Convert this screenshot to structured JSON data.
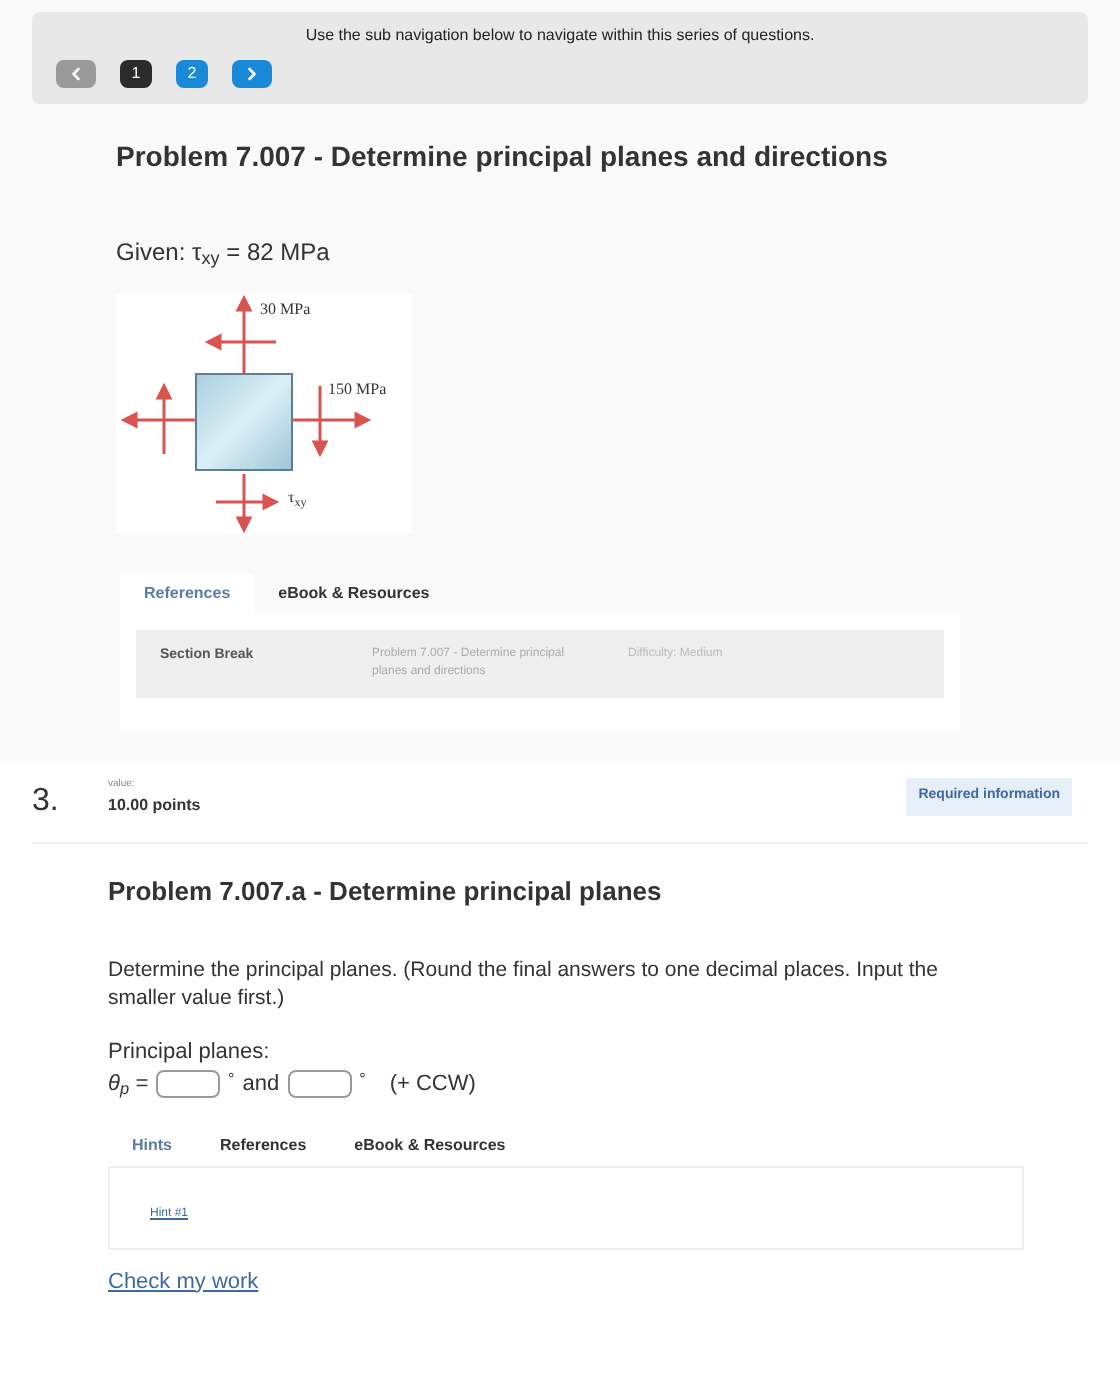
{
  "sub_navigation": {
    "instruction": "Use the sub navigation below to navigate within this series of questions.",
    "prev_disabled": true,
    "pages": [
      {
        "label": "1",
        "selected": true
      },
      {
        "label": "2",
        "selected": false
      }
    ]
  },
  "problem": {
    "title": "Problem 7.007 - Determine principal planes and directions",
    "given": "Given: τ$_{xy}$ = 82 MPa",
    "figure_labels": [
      "30 MPa",
      "150 MPa",
      "τ$_{xy}$"
    ],
    "tabs": [
      {
        "label": "References",
        "selected": true
      },
      {
        "label": "eBook & Resources",
        "selected": false
      }
    ],
    "section": {
      "label": "Section Break",
      "description": "Problem 7.007 - Determine principal planes and directions",
      "difficulty": "Difficulty: Medium"
    }
  },
  "question": {
    "number": "3.",
    "value_label": "value:",
    "points": "10.00 points",
    "badge": "Required information",
    "title": "Problem 7.007.a - Determine principal planes",
    "prompt": "Determine the principal planes. (Round the final answers to one decimal places. Input the smaller value first.)",
    "answer_label": "Principal planes:",
    "symbol": "θ$_{p}$ =",
    "degree": "°",
    "joiner": "and",
    "direction": "(+ CCW)",
    "tabs": [
      {
        "label": "Hints",
        "selected": true
      },
      {
        "label": "References",
        "selected": false
      },
      {
        "label": "eBook & Resources",
        "selected": false
      }
    ],
    "hint_link": "Hint #1",
    "check_link": "Check my work"
  }
}
